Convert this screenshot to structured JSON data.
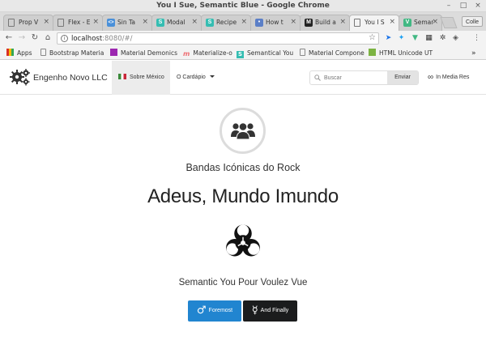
{
  "window": {
    "title": "You I Sue, Semantic Blue - Google Chrome",
    "controls": [
      "–",
      "□",
      "×"
    ]
  },
  "tabs": [
    {
      "label": "Prop V",
      "icon": "doc",
      "color": "#ffffff",
      "active": false
    },
    {
      "label": "Flex - E",
      "icon": "doc",
      "color": "#ffffff",
      "active": false
    },
    {
      "label": "Sin Ta",
      "icon": "<>",
      "color": "#4a90d9",
      "active": false
    },
    {
      "label": "Modal",
      "icon": "S",
      "color": "#35bdb2",
      "active": false
    },
    {
      "label": "Recipe",
      "icon": "S",
      "color": "#35bdb2",
      "active": false
    },
    {
      "label": "How t",
      "icon": "•",
      "color": "#5b7fc7",
      "active": false
    },
    {
      "label": "Build a",
      "icon": "M",
      "color": "#222222",
      "active": false
    },
    {
      "label": "You I S",
      "icon": "doc",
      "color": "#ffffff",
      "active": true
    },
    {
      "label": "Seman",
      "icon": "V",
      "color": "#41b883",
      "active": false
    }
  ],
  "profile_label": "Colle",
  "address": {
    "host": "localhost",
    "path": ":8080/#/"
  },
  "bookmarks": [
    {
      "label": "Apps",
      "icon": "apps",
      "color": "#d93025"
    },
    {
      "label": "Bootstrap Materia",
      "icon": "doc",
      "color": "#888888"
    },
    {
      "label": "Material Demonics",
      "icon": "sq",
      "color": "#9c27b0"
    },
    {
      "label": "Materialize-o",
      "icon": "m",
      "color": "#ee6e73"
    },
    {
      "label": "Semantical You",
      "icon": "S",
      "color": "#35bdb2"
    },
    {
      "label": "Material Compone",
      "icon": "doc",
      "color": "#888888"
    },
    {
      "label": "HTML Unicode UT",
      "icon": "sq",
      "color": "#7cb342"
    }
  ],
  "bookmarks_more": "»",
  "navbar": {
    "brand": "Engenho Novo LLC",
    "items": [
      {
        "label": "Sobre México",
        "active": true,
        "flag": true
      },
      {
        "label": "O Cardápio",
        "active": false,
        "dropdown": true
      }
    ],
    "search_placeholder": "Buscar",
    "search_button": "Enviar",
    "right_link": "In Media Res"
  },
  "main": {
    "subtitle": "Bandas Icónicas do Rock",
    "headline": "Adeus, Mundo Imundo",
    "tagline": "Semantic You Pour Voulez Vue",
    "buttons": [
      {
        "label": "Foremost",
        "symbol": "♂",
        "style": "blue"
      },
      {
        "label": "And Finally",
        "symbol": "☿",
        "style": "dark"
      }
    ]
  }
}
